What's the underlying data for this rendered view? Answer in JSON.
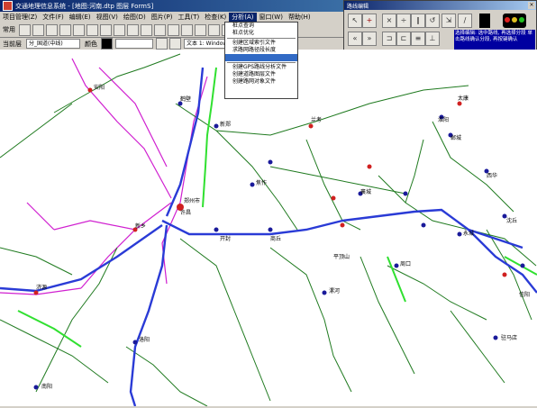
{
  "titlebar": {
    "text": "交通地理信息系统 - [地图:河南.dtp 图层 FormS]"
  },
  "menubar": {
    "items": [
      "项目管理(Z)",
      "文件(F)",
      "编辑(E)",
      "视图(V)",
      "绘图(D)",
      "图片(P)",
      "工具(T)",
      "检查(K)",
      "分析(A)",
      "窗口(W)",
      "帮助(H)"
    ]
  },
  "toolbar1": {
    "label": "常用"
  },
  "toolbar2": {
    "layer_label": "当前层",
    "layer_value": "分_国道(中线)",
    "style_label": "颜色",
    "text_label": "文本 1: Windows默认文字"
  },
  "dropdown": {
    "items": [
      "桩点查询",
      "桩点优化",
      "",
      "创建区域索引文件",
      "求路网路径段长度",
      "",
      "创建GPS路线分析文件",
      "创建道路图层文件",
      "创建路网对象文件"
    ],
    "selected_index": 5
  },
  "panel": {
    "title": "路线编辑",
    "close": "×",
    "info": "选择编辑: 选中路线, 再选择分段 单击路线确认分段, 再按键确认"
  },
  "map": {
    "labels": [
      "许昌",
      "新郑",
      "郑州市",
      "商丘",
      "开封",
      "兰考",
      "永城",
      "安阳",
      "鹤壁",
      "新乡",
      "焦作",
      "济源",
      "洛阳",
      "平顶山",
      "漯河",
      "周口",
      "驻马店",
      "信阳",
      "南阳",
      "三门峡",
      "濮阳",
      "鲁山",
      "叶县",
      "舞阳",
      "襄城",
      "西华",
      "沈丘",
      "郸城",
      "淮阳",
      "太康"
    ],
    "colors": {
      "expressway": "#2a3bd6",
      "national": "#1f7a1f",
      "provincial": "#d020d0",
      "railway": "#30e030",
      "city": "#d02020",
      "node": "#1a1a9a"
    }
  }
}
